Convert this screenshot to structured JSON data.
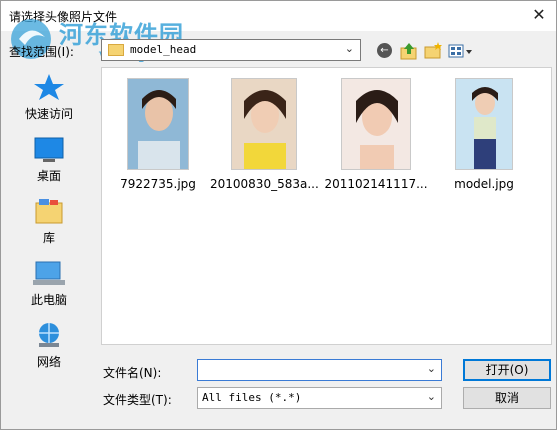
{
  "window": {
    "title": "请选择头像照片文件",
    "close_glyph": "✕"
  },
  "watermark": {
    "text": "河东软件园",
    "url": "www.pc0359.cn"
  },
  "lookin": {
    "label": "查找范围(I):",
    "value": "model_head"
  },
  "places": [
    {
      "label": "快速访问",
      "icon": "star-icon"
    },
    {
      "label": "桌面",
      "icon": "desktop-icon"
    },
    {
      "label": "库",
      "icon": "library-icon"
    },
    {
      "label": "此电脑",
      "icon": "computer-icon"
    },
    {
      "label": "网络",
      "icon": "network-icon"
    }
  ],
  "files": [
    {
      "name": "7922735.jpg"
    },
    {
      "name": "20100830_583a..."
    },
    {
      "name": "201102141117..."
    },
    {
      "name": "model.jpg"
    }
  ],
  "filename": {
    "label": "文件名(N):",
    "value": ""
  },
  "filetype": {
    "label": "文件类型(T):",
    "value": "All files (*.*)"
  },
  "buttons": {
    "open": "打开(O)",
    "cancel": "取消"
  },
  "colors": {
    "accent": "#0078d7",
    "star": "#1e88e5",
    "folder": "#f5d372"
  }
}
